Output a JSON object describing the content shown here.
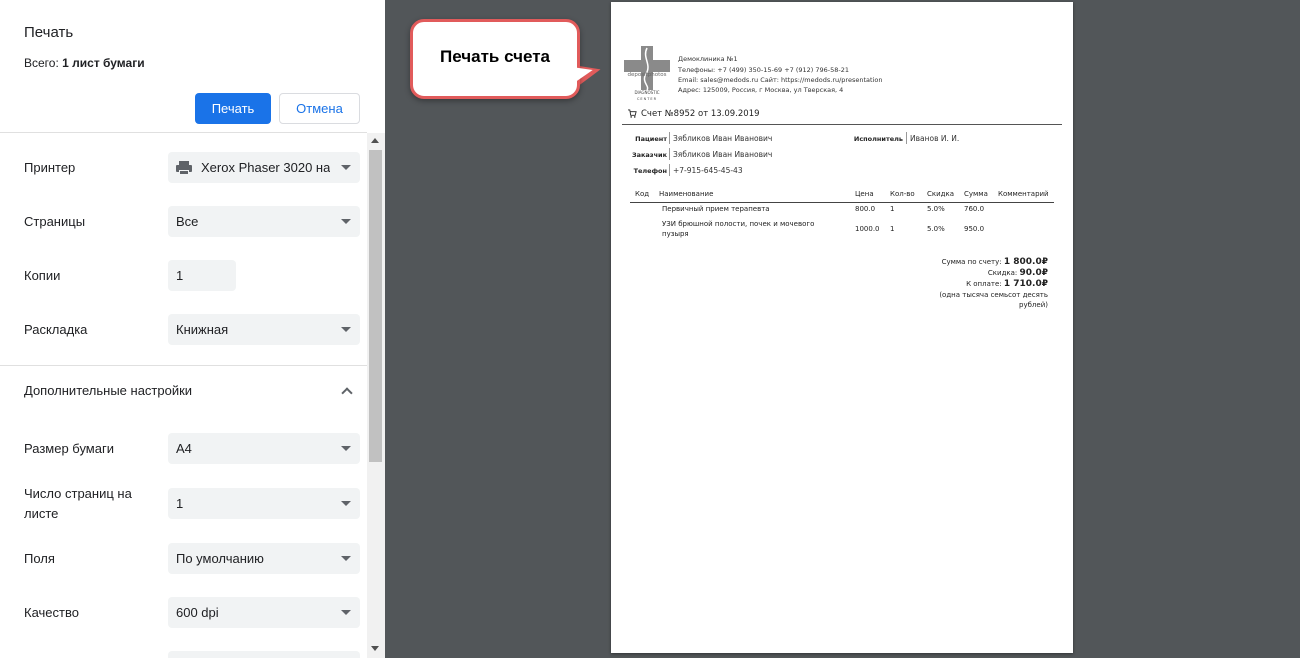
{
  "panel": {
    "title": "Печать",
    "total_prefix": "Всего: ",
    "total_value": "1 лист бумаги",
    "print_label": "Печать",
    "cancel_label": "Отмена",
    "printer_label": "Принтер",
    "printer_value": "Xerox Phaser 3020 на",
    "pages_label": "Страницы",
    "pages_value": "Все",
    "copies_label": "Копии",
    "copies_value": "1",
    "layout_label": "Раскладка",
    "layout_value": "Книжная",
    "advanced_label": "Дополнительные настройки",
    "paper_label": "Размер бумаги",
    "paper_value": "A4",
    "per_sheet_label_1": "Число страниц на",
    "per_sheet_label_2": "листе",
    "per_sheet_value": "1",
    "margins_label": "Поля",
    "margins_value": "По умолчанию",
    "quality_label": "Качество",
    "quality_value": "600 dpi"
  },
  "callout": {
    "text": "Печать счета"
  },
  "document": {
    "logo_text_top": "depositphotos",
    "logo_text_mid": "DIAGNOSTIC",
    "logo_text_bot": "CENTER",
    "clinic_name": "Демоклиника №1",
    "clinic_phones": "Телефоны: +7 (499) 350-15-69 +7 (912) 796-58-21",
    "clinic_email": "Email: sales@medods.ru Сайт: https://medods.ru/presentation",
    "clinic_address": "Адрес: 125009, Россия, г Москва, ул Тверская, 4",
    "invoice_title": "Счет №8952 от 13.09.2019",
    "patient_label": "Пациент",
    "patient_value": "Зябликов Иван Иванович",
    "executor_label": "Исполнитель",
    "executor_value": "Иванов И. И.",
    "customer_label": "Заказчик",
    "customer_value": "Зябликов Иван Иванович",
    "phone_label": "Телефон",
    "phone_value": "+7-915-645-45-43",
    "columns": [
      "Код",
      "Наименование",
      "Цена",
      "Кол-во",
      "Скидка",
      "Сумма",
      "Комментарий"
    ],
    "rows": [
      {
        "code": "",
        "name_1": "Первичный прием терапевта",
        "name_2": "",
        "price": "800.0",
        "qty": "1",
        "discount": "5.0%",
        "sum": "760.0",
        "comment": ""
      },
      {
        "code": "",
        "name_1": "УЗИ брюшной полости, почек и мочевого",
        "name_2": "пузыря",
        "price": "1000.0",
        "qty": "1",
        "discount": "5.0%",
        "sum": "950.0",
        "comment": ""
      }
    ],
    "total_label": "Сумма по счету:",
    "total_value": "1 800.0₽",
    "discount_label": "Скидка:",
    "discount_value": "90.0₽",
    "pay_label": "К оплате:",
    "pay_value": "1 710.0₽",
    "words_1": "(одна тысяча семьсот десять",
    "words_2": "рублей)"
  }
}
